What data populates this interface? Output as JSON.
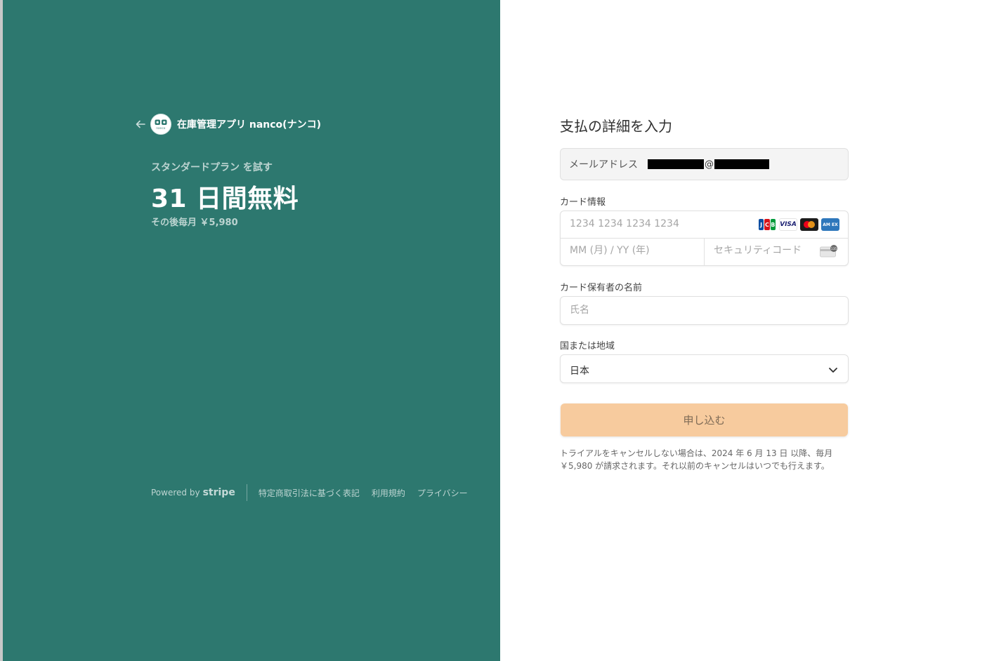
{
  "colors": {
    "brand": "#2d786f",
    "button": "#f7cb9e"
  },
  "merchant": {
    "back_icon": "arrow-left-icon",
    "logo_text": "nanco",
    "name": "在庫管理アプリ nanco(ナンコ)"
  },
  "offer": {
    "plan": "スタンダードプラン を試す",
    "trial": "31 日間無料",
    "after": "その後毎月 ￥5,980"
  },
  "footer": {
    "powered_by": "Powered by",
    "stripe": "stripe",
    "links": [
      "特定商取引法に基づく表記",
      "利用規約",
      "プライバシー"
    ]
  },
  "form": {
    "title": "支払の詳細を入力",
    "email_label": "メールアドレス",
    "email_at": "@",
    "card_label": "カード情報",
    "card_number_placeholder": "1234 1234 1234 1234",
    "card_brands": [
      "JCB",
      "VISA",
      "Mastercard",
      "AMEX"
    ],
    "expiry_placeholder": "MM (月) / YY (年)",
    "cvc_placeholder": "セキュリティコード",
    "cvc_icon": "card-cvc-icon",
    "holder_label": "カード保有者の名前",
    "holder_placeholder": "氏名",
    "country_label": "国または地域",
    "country_value": "日本",
    "submit_label": "申し込む",
    "notice": "トライアルをキャンセルしない場合は、2024 年 6 月 13 日 以降、毎月 ￥5,980 が請求されます。それ以前のキャンセルはいつでも行えます。"
  }
}
